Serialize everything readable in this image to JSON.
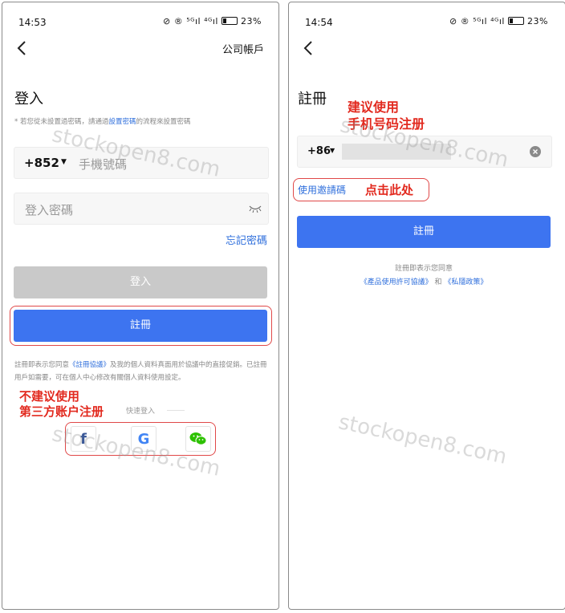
{
  "left": {
    "status": {
      "time": "14:53",
      "icons": "⊘ ® ⁵ᴳıl ⁴ᴳıl",
      "battery": "23%"
    },
    "header_action": "公司帳戶",
    "title": "登入",
    "notice": {
      "prefix": "* 若您從未設置過密碼，請通過",
      "link": "設置密碼",
      "suffix": "的流程來設置密碼"
    },
    "phone": {
      "code": "+852",
      "placeholder": "手機號碼"
    },
    "password": {
      "placeholder": "登入密碼"
    },
    "forgot": "忘記密碼",
    "login_button": "登入",
    "register_button": "註冊",
    "agreement": {
      "prefix": "註冊即表示您同意",
      "link": "《註冊協議》",
      "suffix": "及我的個人資料真面用於協議中的直接促銷。已註冊用戶如需要，可在個人中心修改有關個人資料使用設定。"
    },
    "quick_login": "快速登入",
    "annotation": {
      "line1": "不建议使用",
      "line2": "第三方账户注册"
    },
    "social": {
      "facebook": "f",
      "google": "G"
    },
    "watermarks": [
      "stockopen8.com",
      "stockopen8.com"
    ]
  },
  "right": {
    "status": {
      "time": "14:54",
      "icons": "⊘ ® ⁵ᴳıl ⁴ᴳıl",
      "battery": "23%"
    },
    "title": "註冊",
    "annotation_top": {
      "line1": "建议使用",
      "line2": "手机号码注册"
    },
    "phone": {
      "code": "+86"
    },
    "invite": "使用邀請碼",
    "annotation_invite": "点击此处",
    "register_button": "註冊",
    "agreement_line": "註冊即表示您同意",
    "agreement_links": {
      "product": "《產品使用許可協議》",
      "and": "和",
      "privacy": "《私隱政策》"
    },
    "watermarks": [
      "stockopen8.com",
      "stockopen8.com"
    ]
  }
}
